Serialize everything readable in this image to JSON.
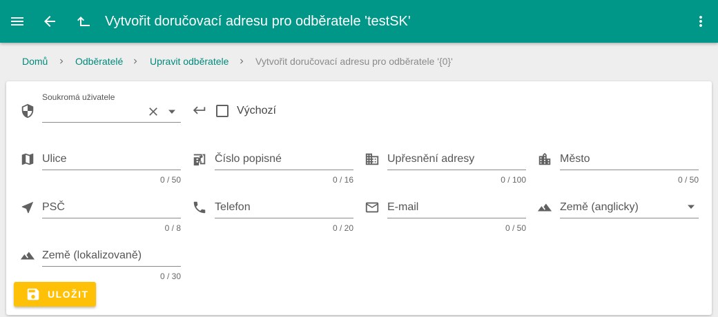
{
  "appbar": {
    "title": "Vytvořit doručovací adresu pro odběratele 'testSK'",
    "menu_icon": "menu-icon",
    "back_icon": "arrow-back-icon",
    "up_icon": "level-up-icon",
    "more_icon": "more-vert-icon"
  },
  "breadcrumb": {
    "items": [
      "Domů",
      "Odběratelé",
      "Upravit odběratele"
    ],
    "current": "Vytvořit doručovací adresu pro odběratele '{0}'"
  },
  "form": {
    "private_user": {
      "label": "Soukromá uživatele",
      "value": ""
    },
    "default_checkbox": {
      "label": "Výchozí",
      "checked": false
    },
    "fields": [
      {
        "key": "street",
        "placeholder": "Ulice",
        "counter": "0 / 50",
        "icon": "map-icon"
      },
      {
        "key": "number",
        "placeholder": "Číslo popisné",
        "counter": "0 / 16",
        "icon": "store-24-icon"
      },
      {
        "key": "detail",
        "placeholder": "Upřesnění adresy",
        "counter": "0 / 100",
        "icon": "business-icon"
      },
      {
        "key": "city",
        "placeholder": "Město",
        "counter": "0 / 50",
        "icon": "location-city-icon"
      },
      {
        "key": "zip",
        "placeholder": "PSČ",
        "counter": "0 / 8",
        "icon": "navigation-icon"
      },
      {
        "key": "phone",
        "placeholder": "Telefon",
        "counter": "0 / 20",
        "icon": "phone-icon"
      },
      {
        "key": "email",
        "placeholder": "E-mail",
        "counter": "0 / 50",
        "icon": "mail-icon"
      },
      {
        "key": "country_en",
        "placeholder": "Země (anglicky)",
        "icon": "terrain-icon"
      },
      {
        "key": "country_local",
        "placeholder": "Země (lokalizovaně)",
        "counter": "0 / 30",
        "icon": "terrain-icon"
      }
    ]
  },
  "save_button": {
    "label": "ULOŽIT",
    "icon": "save-icon"
  },
  "colors": {
    "primary": "#009688",
    "accent": "#ffc107",
    "link": "#00897b"
  }
}
